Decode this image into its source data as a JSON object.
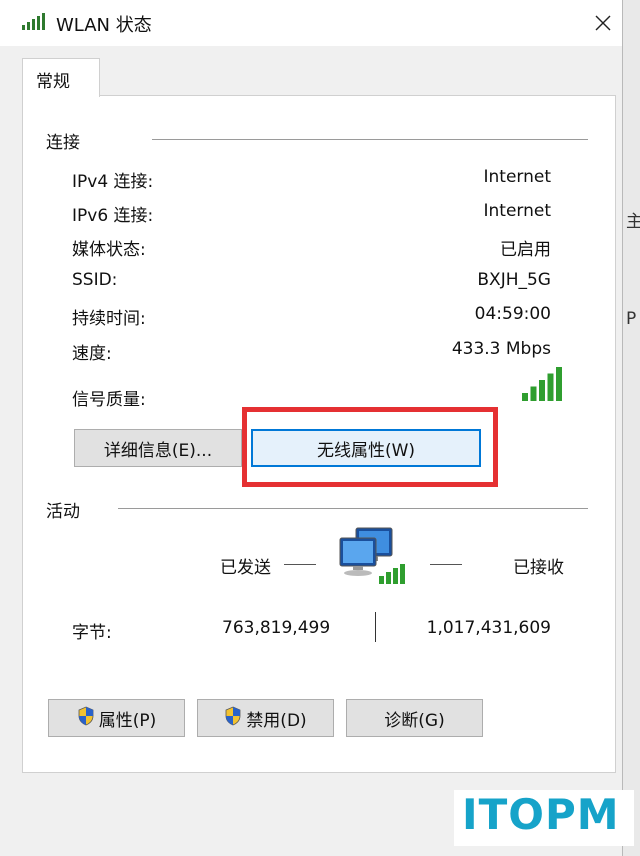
{
  "window": {
    "title": "WLAN 状态"
  },
  "tabs": [
    {
      "label": "常规"
    }
  ],
  "connection": {
    "section_title": "连接",
    "rows": [
      {
        "label": "IPv4 连接:",
        "value": "Internet"
      },
      {
        "label": "IPv6 连接:",
        "value": "Internet"
      },
      {
        "label": "媒体状态:",
        "value": "已启用"
      },
      {
        "label": "SSID:",
        "value": "BXJH_5G"
      },
      {
        "label": "持续时间:",
        "value": "04:59:00"
      },
      {
        "label": "速度:",
        "value": "433.3 Mbps"
      }
    ],
    "signal_label": "信号质量:",
    "signal_bars": 5,
    "details_button": "详细信息(E)...",
    "wireless_button": "无线属性(W)"
  },
  "activity": {
    "section_title": "活动",
    "sent_label": "已发送",
    "received_label": "已接收",
    "bytes_label": "字节:",
    "bytes_sent": "763,819,499",
    "bytes_received": "1,017,431,609"
  },
  "buttons": {
    "properties": "属性(P)",
    "disable": "禁用(D)",
    "diagnose": "诊断(G)"
  },
  "watermark": "ITOPM",
  "side_fragments": [
    "主",
    "P"
  ],
  "colors": {
    "highlight": "#e53032",
    "accent": "#0078d7",
    "signal": "#2f9e2f",
    "watermark": "#16a3c9"
  }
}
